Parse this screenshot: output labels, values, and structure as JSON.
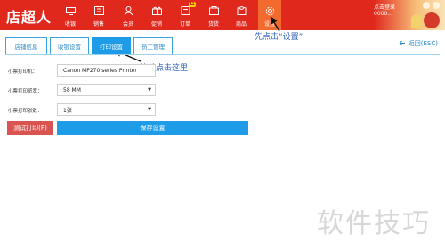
{
  "app": {
    "logo": "店超人"
  },
  "nav": [
    {
      "label": "收银",
      "icon": "monitor-icon",
      "active": false
    },
    {
      "label": "销售",
      "icon": "sales-icon",
      "active": false
    },
    {
      "label": "会员",
      "icon": "member-icon",
      "active": false
    },
    {
      "label": "促销",
      "icon": "promotion-icon",
      "active": false
    },
    {
      "label": "订单",
      "icon": "order-icon",
      "active": false,
      "badge": "11"
    },
    {
      "label": "货货",
      "icon": "goods-icon",
      "active": false
    },
    {
      "label": "商品",
      "icon": "product-icon",
      "active": false
    },
    {
      "label": "设置",
      "icon": "gear-icon",
      "active": true
    }
  ],
  "promo": {
    "text": "点击登录0000..."
  },
  "annotations": {
    "settings": "先点击“设置”",
    "ticket": "接着点击这里"
  },
  "tabs": [
    {
      "label": "店铺信息",
      "active": false
    },
    {
      "label": "收银设置",
      "active": false
    },
    {
      "label": "打印设置",
      "active": true
    },
    {
      "label": "员工管理",
      "active": false
    }
  ],
  "back": {
    "label": "返回(ESC)",
    "icon": "back-arrow-icon"
  },
  "form": {
    "printer": {
      "label": "小票打印机：",
      "value": "Canon MP270 series Printer"
    },
    "paper": {
      "label": "小票打印纸宽：",
      "value": "58 MM"
    },
    "copies": {
      "label": "小票打印张数：",
      "value": "1张"
    }
  },
  "buttons": {
    "test": "测试打印(P)",
    "save": "保存设置"
  },
  "watermark": "软件技巧",
  "colors": {
    "topbar": "#e0281d",
    "accent": "#1e9ce8",
    "danger": "#d9534f",
    "annotation": "#2d5fb3"
  }
}
